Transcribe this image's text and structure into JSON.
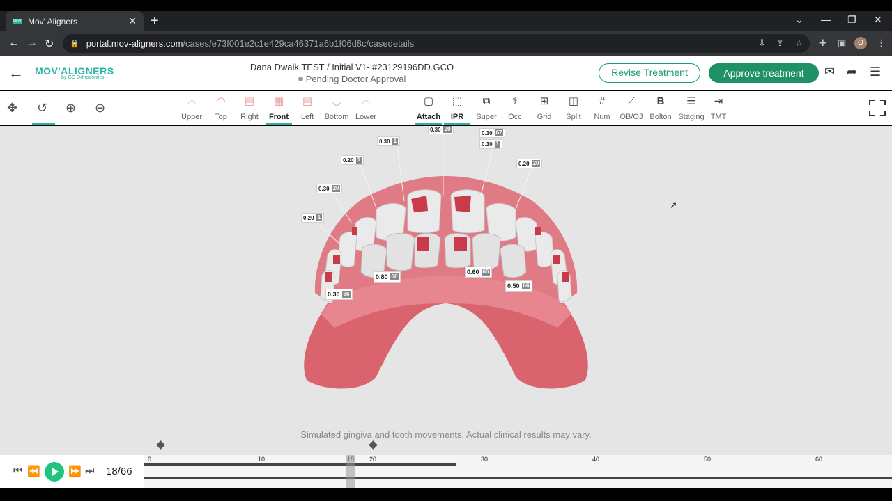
{
  "browser": {
    "tab_title": "Mov' Aligners",
    "tab_favicon": "MOV'",
    "url_host": "portal.mov-aligners.com",
    "url_path": "/cases/e73f001e2c1e429ca46371a6b1f06d8c/casedetails",
    "profile_initial": "O"
  },
  "header": {
    "logo": "MOV'ALIGNERS",
    "logo_sub": "by GC Orthodontics",
    "case_title": "Dana Dwaik TEST / Initial V1- #23129196DD.GCO",
    "status": "Pending Doctor Approval",
    "revise_label": "Revise Treatment",
    "approve_label": "Approve treatment",
    "accent_color": "#1f9166"
  },
  "views": [
    {
      "label": "Upper"
    },
    {
      "label": "Top"
    },
    {
      "label": "Right"
    },
    {
      "label": "Front",
      "active": true
    },
    {
      "label": "Left"
    },
    {
      "label": "Bottom"
    },
    {
      "label": "Lower"
    }
  ],
  "tools": [
    {
      "label": "Attach",
      "active": true
    },
    {
      "label": "IPR",
      "active": true
    },
    {
      "label": "Super"
    },
    {
      "label": "Occ"
    },
    {
      "label": "Grid"
    },
    {
      "label": "Split"
    },
    {
      "label": "Num"
    },
    {
      "label": "OB/OJ"
    },
    {
      "label": "Bolton"
    },
    {
      "label": "Staging"
    },
    {
      "label": "TMT"
    }
  ],
  "ipr_labels": [
    {
      "value": "0.30",
      "step": "20"
    },
    {
      "value": "0.30",
      "step": "67"
    },
    {
      "value": "0.30",
      "step": "1"
    },
    {
      "value": "0.30",
      "step": "1"
    },
    {
      "value": "0.20",
      "step": "1"
    },
    {
      "value": "0.20",
      "step": "20"
    },
    {
      "value": "0.30",
      "step": "20"
    },
    {
      "value": "0.20",
      "step": "1"
    },
    {
      "value": "0.80",
      "step": "66"
    },
    {
      "value": "0.60",
      "step": "66"
    },
    {
      "value": "0.50",
      "step": "66"
    },
    {
      "value": "0.30",
      "step": "66"
    }
  ],
  "disclaimer": "Simulated gingiva and tooth movements. Actual clinical results may vary.",
  "timeline": {
    "current_step": "18",
    "total_steps": "66",
    "step_display": "18/66",
    "ticks": [
      "0",
      "10",
      "18",
      "20",
      "30",
      "40",
      "50",
      "60"
    ]
  }
}
